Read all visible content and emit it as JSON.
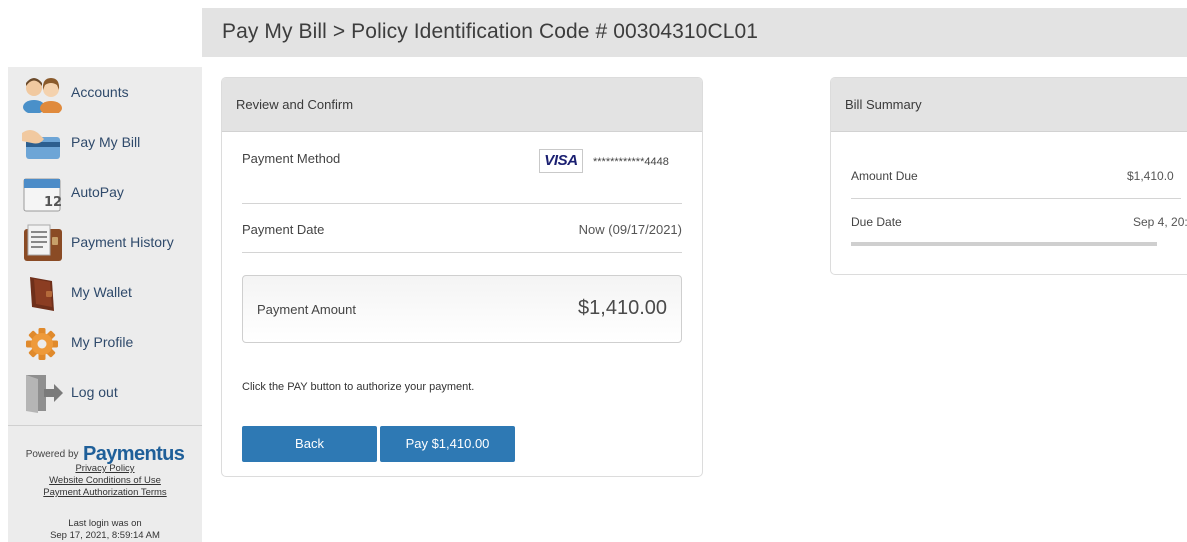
{
  "header": {
    "title": "Pay My Bill > Policy Identification Code # 00304310CL01"
  },
  "sidebar": {
    "items": [
      {
        "label": "Accounts",
        "icon": "accounts-icon"
      },
      {
        "label": "Pay My Bill",
        "icon": "pay-bill-card-icon"
      },
      {
        "label": "AutoPay",
        "icon": "calendar-icon"
      },
      {
        "label": "Payment History",
        "icon": "payment-history-icon"
      },
      {
        "label": "My Wallet",
        "icon": "wallet-icon"
      },
      {
        "label": "My Profile",
        "icon": "gear-icon"
      },
      {
        "label": "Log out",
        "icon": "logout-door-icon"
      }
    ],
    "calendar_day": "12",
    "powered_by": "Powered by",
    "brand": "Paymentus",
    "links": [
      "Privacy Policy",
      "Website Conditions of Use",
      "Payment Authorization Terms"
    ],
    "last_login_label": "Last login was on",
    "last_login_value": "Sep 17, 2021, 8:59:14 AM"
  },
  "review": {
    "title": "Review and Confirm",
    "payment_method_label": "Payment Method",
    "card_brand": "VISA",
    "card_mask": "************4448",
    "payment_date_label": "Payment Date",
    "payment_date_value": "Now (09/17/2021)",
    "payment_amount_label": "Payment Amount",
    "payment_amount_value": "$1,410.00",
    "instruction": "Click the PAY button to authorize your payment.",
    "back_label": "Back",
    "pay_label": "Pay $1,410.00"
  },
  "summary": {
    "title": "Bill Summary",
    "amount_due_label": "Amount Due",
    "amount_due_value": "$1,410.0",
    "due_date_label": "Due Date",
    "due_date_value": "Sep 4, 20:"
  },
  "colors": {
    "button": "#2e79b4",
    "nav_text": "#2f4a6b",
    "brand": "#1f5f99",
    "header_bg": "#e3e3e3",
    "sidebar_bg": "#ececec"
  }
}
